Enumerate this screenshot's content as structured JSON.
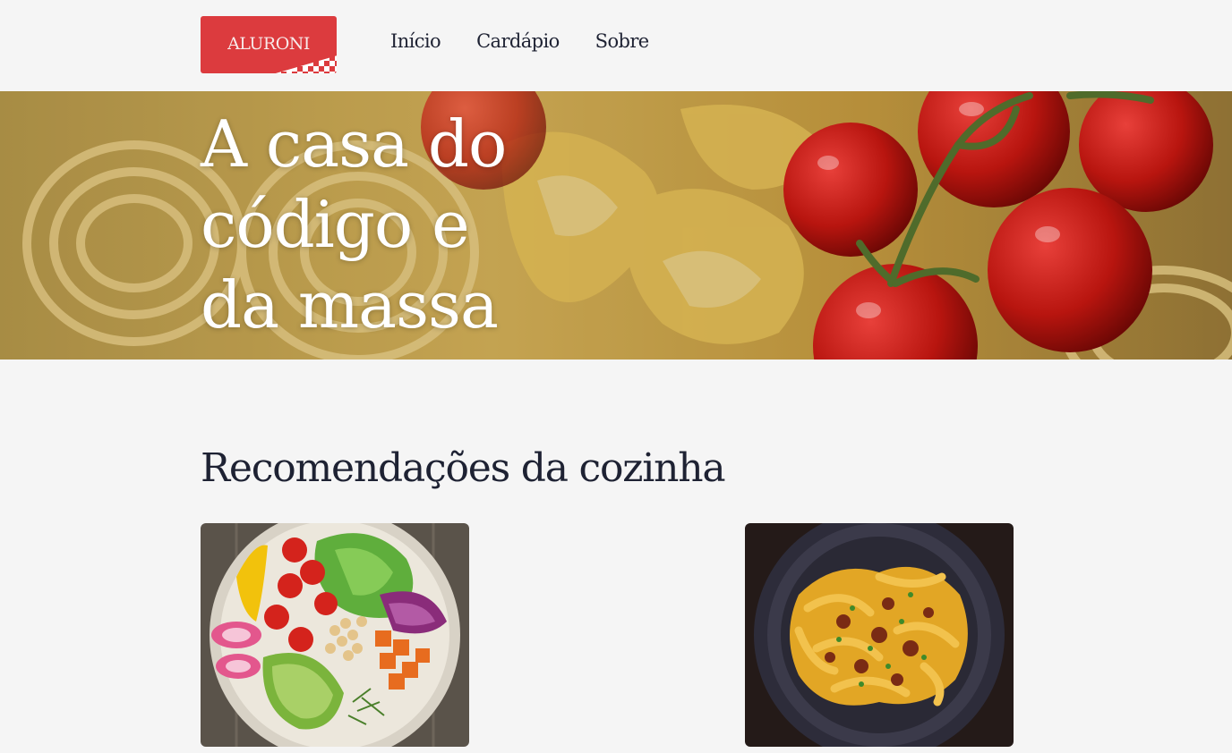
{
  "header": {
    "logo_text": "ALURONI",
    "nav": [
      {
        "label": "Início"
      },
      {
        "label": "Cardápio"
      },
      {
        "label": "Sobre"
      }
    ]
  },
  "hero": {
    "title_lines": [
      "A casa do",
      "código e",
      "da massa"
    ]
  },
  "recommendations": {
    "title": "Recomendações da cozinha"
  },
  "colors": {
    "brand_red": "#dc3b3e",
    "text_dark": "#1e2233",
    "background": "#f5f5f5"
  }
}
